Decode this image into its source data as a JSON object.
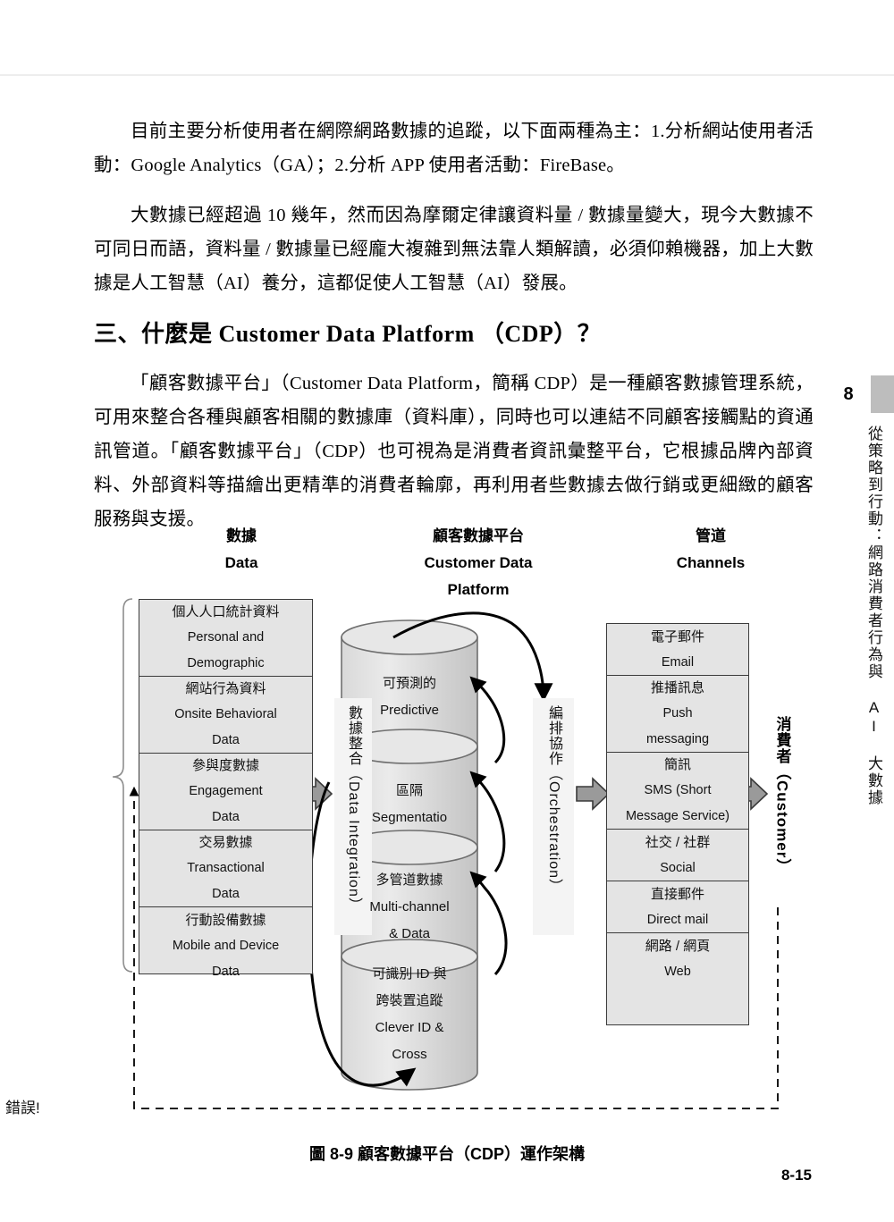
{
  "page": {
    "folio": "8-15",
    "chapter_number": "8",
    "chapter_title": "從策略到行動：網路消費者行為與 AI 大數據"
  },
  "body": {
    "paragraphs": [
      "目前主要分析使用者在網際網路數據的追蹤，以下面兩種為主：1.分析網站使用者活動：Google Analytics（GA）；2.分析 APP 使用者活動：FireBase。",
      "大數據已經超過 10 幾年，然而因為摩爾定律讓資料量 / 數據量變大，現今大數據不可同日而語，資料量 / 數據量已經龐大複雜到無法靠人類解讀，必須仰賴機器，加上大數據是人工智慧（AI）養分，這都促使人工智慧（AI）發展。"
    ],
    "heading": "三、什麼是 Customer Data Platform （CDP）？",
    "paragraph_after_heading": "「顧客數據平台」（Customer Data Platform，簡稱 CDP）是一種顧客數據管理系統，可用來整合各種與顧客相關的數據庫（資料庫），同時也可以連結不同顧客接觸點的資通訊管道。「顧客數據平台」（CDP）也可視為是消費者資訊彙整平台，它根據品牌內部資料、外部資料等描繪出更精準的消費者輪廓，再利用者些數據去做行銷或更細緻的顧客服務與支援。"
  },
  "figure": {
    "caption": "圖 8-9  顧客數據平台（CDP）運作架構",
    "error_label": "錯誤!",
    "columns": {
      "data": {
        "zh": "數據",
        "en": "Data"
      },
      "platform": {
        "zh": "顧客數據平台",
        "en_line1": "Customer Data",
        "en_line2": "Platform"
      },
      "channels": {
        "zh": "管道",
        "en": "Channels"
      }
    },
    "data_items": [
      {
        "zh": "個人人口統計資料",
        "en": [
          "Personal and",
          "Demographic"
        ]
      },
      {
        "zh": "網站行為資料",
        "en": [
          "Onsite Behavioral",
          "Data"
        ]
      },
      {
        "zh": "參與度數據",
        "en": [
          "Engagement",
          "Data"
        ]
      },
      {
        "zh": "交易數據",
        "en": [
          "Transactional",
          "Data"
        ]
      },
      {
        "zh": "行動設備數據",
        "en": [
          "Mobile and Device",
          "Data"
        ]
      }
    ],
    "platform_items": [
      {
        "zh": [
          "可預測的"
        ],
        "en": [
          "Predictive"
        ]
      },
      {
        "zh": [
          "區隔"
        ],
        "en": [
          "Segmentatio"
        ]
      },
      {
        "zh": [
          "多管道數據"
        ],
        "en": [
          "Multi-channel",
          "& Data"
        ]
      },
      {
        "zh": [
          "可識別 ID 與",
          "跨裝置追蹤"
        ],
        "en": [
          "Clever ID &",
          "Cross"
        ]
      }
    ],
    "channel_items": [
      {
        "zh": "電子郵件",
        "en": [
          "Email"
        ]
      },
      {
        "zh": "推播訊息",
        "en": [
          "Push",
          "messaging"
        ]
      },
      {
        "zh": "簡訊",
        "en": [
          "SMS (Short",
          "Message Service)"
        ]
      },
      {
        "zh": "社交 / 社群",
        "en": [
          "Social"
        ]
      },
      {
        "zh": "直接郵件",
        "en": [
          "Direct mail"
        ]
      },
      {
        "zh": "網路 / 網頁",
        "en": [
          "Web"
        ]
      }
    ],
    "vertical_labels": {
      "integration": "數據整合（Data Integration）",
      "orchestration": "編排協作（Orchestration）",
      "customer": "消費者（Customer）"
    },
    "colors": {
      "box_fill": "#e4e4e4",
      "box_stroke": "#3b3b3b",
      "band_fill": "#f4f4f4",
      "arrow_fill": "#9a9a9a",
      "chapter_tab": "#bdbdbd"
    }
  }
}
